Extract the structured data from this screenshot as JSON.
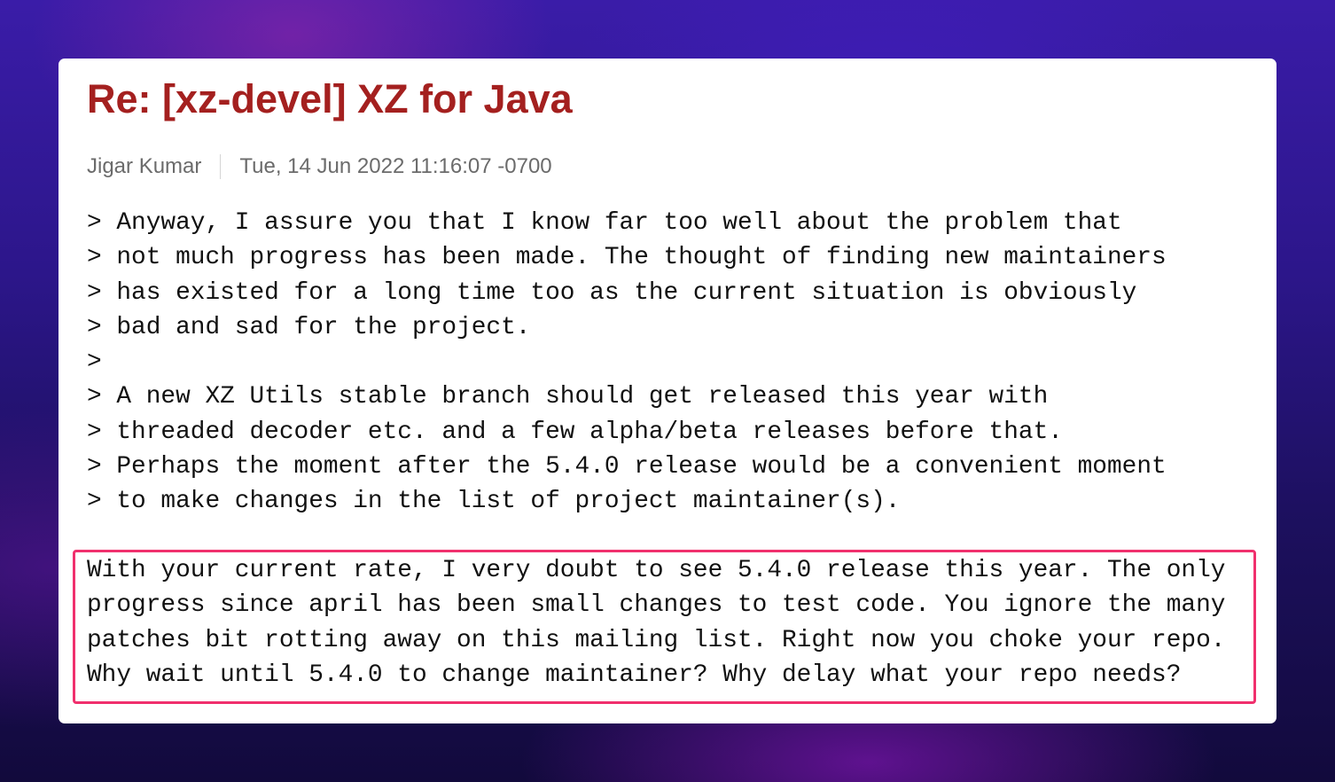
{
  "email": {
    "subject": "Re: [xz-devel] XZ for Java",
    "author": "Jigar Kumar",
    "date": "Tue, 14 Jun 2022 11:16:07 -0700",
    "quoted_lines": [
      "> Anyway, I assure you that I know far too well about the problem that",
      "> not much progress has been made. The thought of finding new maintainers",
      "> has existed for a long time too as the current situation is obviously",
      "> bad and sad for the project.",
      ">",
      "> A new XZ Utils stable branch should get released this year with",
      "> threaded decoder etc. and a few alpha/beta releases before that.",
      "> Perhaps the moment after the 5.4.0 release would be a convenient moment",
      "> to make changes in the list of project maintainer(s)."
    ],
    "reply_lines": [
      "With your current rate, I very doubt to see 5.4.0 release this year. The only",
      "progress since april has been small changes to test code. You ignore the many",
      "patches bit rotting away on this mailing list. Right now you choke your repo.",
      "Why wait until 5.4.0 to change maintainer? Why delay what your repo needs?"
    ]
  },
  "colors": {
    "subject": "#a4201f",
    "meta_text": "#6b6b6b",
    "highlight_border": "#f0306d",
    "card_background": "#ffffff"
  }
}
